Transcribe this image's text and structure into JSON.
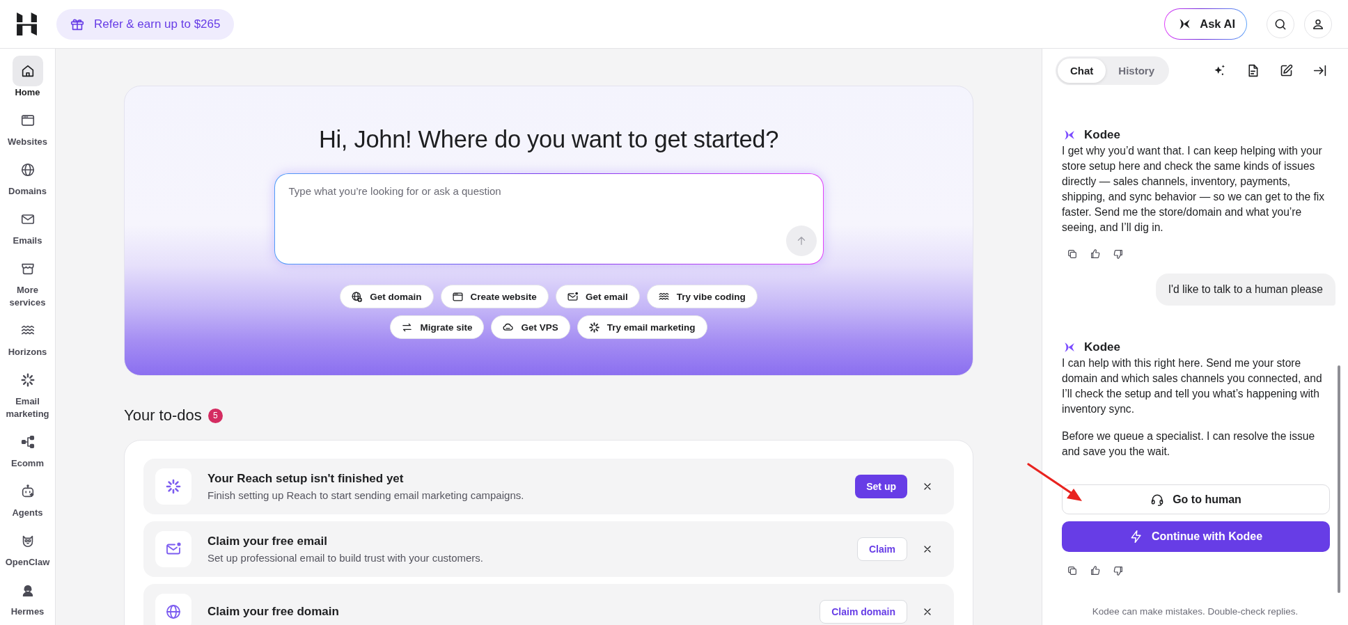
{
  "top_bar": {
    "promo": "Refer & earn up to $265",
    "ask_ai": "Ask AI"
  },
  "sidebar": {
    "items": [
      {
        "label": "Home",
        "selected": true
      },
      {
        "label": "Websites",
        "selected": false
      },
      {
        "label": "Domains",
        "selected": false
      },
      {
        "label": "Emails",
        "selected": false
      },
      {
        "label": "More services",
        "selected": false
      },
      {
        "label": "Horizons",
        "selected": false
      },
      {
        "label": "Email marketing",
        "selected": false
      },
      {
        "label": "Ecomm",
        "selected": false
      },
      {
        "label": "Agents",
        "selected": false
      },
      {
        "label": "OpenClaw",
        "selected": false
      },
      {
        "label": "Hermes",
        "selected": false
      }
    ]
  },
  "hero": {
    "title": "Hi, John! Where do you want to get started?",
    "search": {
      "placeholder": "Type what you’re looking for or ask a question"
    },
    "quick_action_rows": [
      [
        "Get domain",
        "Create website",
        "Get email",
        "Try vibe coding"
      ],
      [
        "Migrate site",
        "Get VPS",
        "Try email marketing"
      ]
    ]
  },
  "todos": {
    "title": "Your to-dos",
    "count": "5",
    "items": [
      {
        "title": "Your Reach setup isn't finished yet",
        "description": "Finish setting up Reach to start sending email marketing campaigns.",
        "action": {
          "label": "Set up",
          "kind": "primary"
        }
      },
      {
        "title": "Claim your free email",
        "description": "Set up professional email to build trust with your customers.",
        "action": {
          "label": "Claim",
          "kind": "outline"
        }
      },
      {
        "title": "Claim your free domain",
        "action": {
          "label": "Claim domain",
          "kind": "outline"
        }
      }
    ]
  },
  "chat": {
    "tabs": [
      {
        "label": "Chat",
        "selected": true
      },
      {
        "label": "History",
        "selected": false
      }
    ],
    "messages": [
      {
        "kind": "assistant",
        "author": "Kodee",
        "paragraphs": [
          "I get why you’d want that. I can keep helping with your store setup here and check the same kinds of issues directly — sales channels, inventory, payments, shipping, and sync behavior — so we can get to the fix faster. Send me the store/domain and what you’re seeing, and I’ll dig in."
        ]
      },
      {
        "kind": "user",
        "text": "I'd like to talk to a human please"
      },
      {
        "kind": "assistant",
        "author": "Kodee",
        "paragraphs": [
          "I can help with this right here. Send me your store domain and which sales channels you connected, and I’ll check the setup and tell you what’s happening with inventory sync.",
          "Before we queue a specialist. I can resolve the issue and save you the wait."
        ],
        "buttons": [
          {
            "label": "Go to human",
            "kind": "outline"
          },
          {
            "label": "Continue with Kodee",
            "kind": "primary"
          }
        ]
      }
    ],
    "footer": "Kodee can make mistakes. Double-check replies."
  }
}
